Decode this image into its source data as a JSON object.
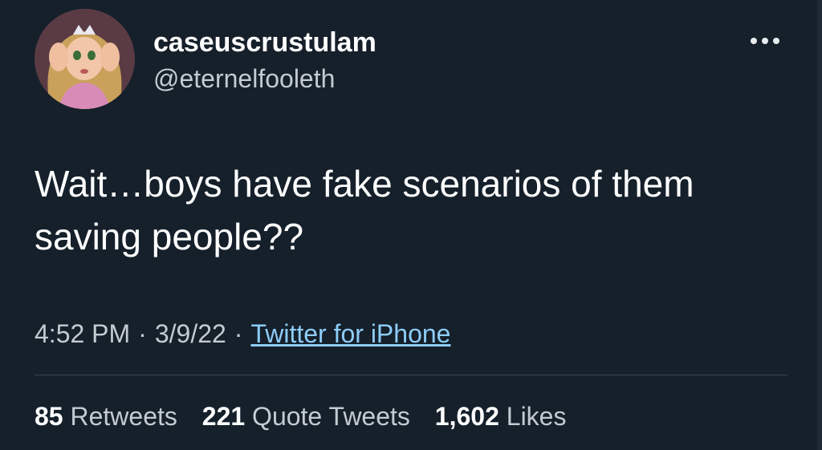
{
  "user": {
    "display_name": "caseuscrustulam",
    "handle": "@eternelfooleth",
    "avatar_icon": "avatar-illustration"
  },
  "tweet": {
    "text": "Wait…boys have fake scenarios of them saving people??"
  },
  "meta": {
    "time": "4:52 PM",
    "date": "3/9/22",
    "separator": "·",
    "source": "Twitter for iPhone"
  },
  "stats": {
    "retweets_count": "85",
    "retweets_label": "Retweets",
    "quotes_count": "221",
    "quotes_label": "Quote Tweets",
    "likes_count": "1,602",
    "likes_label": "Likes"
  },
  "colors": {
    "background": "#15202b",
    "link": "#8ecdf8",
    "secondary_text": "#c4cbd1"
  }
}
